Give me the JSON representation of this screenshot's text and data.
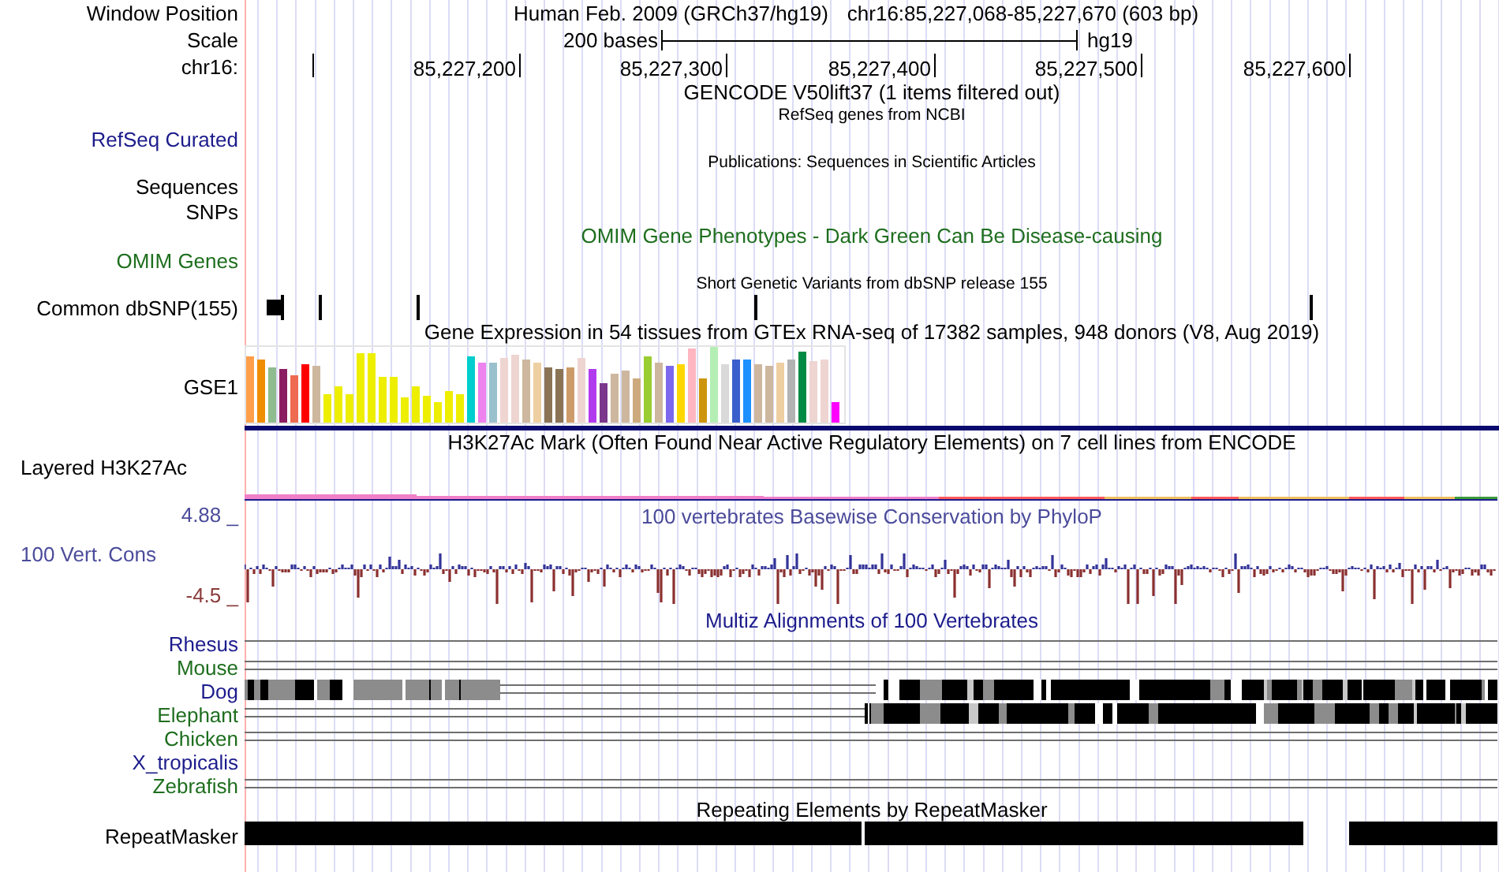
{
  "rows": [
    {
      "kind": "position",
      "label": "Window Position",
      "assembly": "Human Feb. 2009 (GRCh37/hg19)",
      "position": "chr16:85,227,068-85,227,670 (603 bp)"
    },
    {
      "kind": "scale",
      "label": "Scale",
      "length": "200 bases",
      "database": "hg19"
    },
    {
      "kind": "ruler",
      "label": "chr16:",
      "ticks": [
        "85,227,200",
        "85,227,300",
        "85,227,400",
        "85,227,500",
        "85,227,600"
      ]
    },
    {
      "kind": "title",
      "title": "GENCODE V50lift37 (1 items filtered out)"
    },
    {
      "kind": "title",
      "title": "RefSeq genes from NCBI",
      "small": true
    },
    {
      "kind": "label",
      "label": "RefSeq Curated",
      "color": "#1c1c8c"
    },
    {
      "kind": "title",
      "title": "Publications: Sequences in Scientific Articles",
      "small": true
    },
    {
      "kind": "label",
      "label": "Sequences"
    },
    {
      "kind": "label",
      "label": "SNPs"
    },
    {
      "kind": "title",
      "title": "OMIM Gene Phenotypes - Dark Green Can Be Disease-causing",
      "color": "#1e6e1e"
    },
    {
      "kind": "label",
      "label": "OMIM Genes",
      "color": "#1e6e1e"
    },
    {
      "kind": "title",
      "title": "Short Genetic Variants from dbSNP release 155",
      "small": true
    },
    {
      "kind": "snps",
      "label": "Common dbSNP(155)"
    },
    {
      "kind": "title",
      "title": "Gene Expression in 54 tissues from GTEx RNA-seq of 17382 samples, 948 donors (V8, Aug 2019)"
    },
    {
      "kind": "bars",
      "label": "GSE1"
    },
    {
      "kind": "title",
      "title": "H3K27Ac Mark (Often Found Near Active Regulatory Elements) on 7 cell lines from ENCODE"
    },
    {
      "kind": "layered",
      "label": "Layered H3K27Ac"
    },
    {
      "kind": "wiggle",
      "label": "100 Vert. Cons",
      "title": "100 vertebrates Basewise Conservation by PhyloP",
      "max": "4.88 _",
      "min": "-4.5 _",
      "color": "#4b4b9b"
    },
    {
      "kind": "title",
      "title": "Multiz Alignments of 100 Vertebrates",
      "color": "#1c1c8c"
    },
    {
      "kind": "alignments",
      "species": [
        {
          "name": "Rhesus",
          "color": "#1c1c8c",
          "kind": "single"
        },
        {
          "name": "Mouse",
          "color": "#1e6e1e",
          "kind": "double"
        },
        {
          "name": "Dog",
          "color": "#1c1c8c",
          "kind": "blocks"
        },
        {
          "name": "Elephant",
          "color": "#1e6e1e",
          "kind": "blocks"
        },
        {
          "name": "Chicken",
          "color": "#1e6e1e",
          "kind": "double"
        },
        {
          "name": "X_tropicalis",
          "color": "#1c1c8c",
          "kind": "empty"
        },
        {
          "name": "Zebrafish",
          "color": "#1e6e1e",
          "kind": "double"
        }
      ]
    },
    {
      "kind": "title",
      "title": "Repeating Elements by RepeatMasker"
    },
    {
      "kind": "repeats",
      "label": "RepeatMasker"
    }
  ]
}
